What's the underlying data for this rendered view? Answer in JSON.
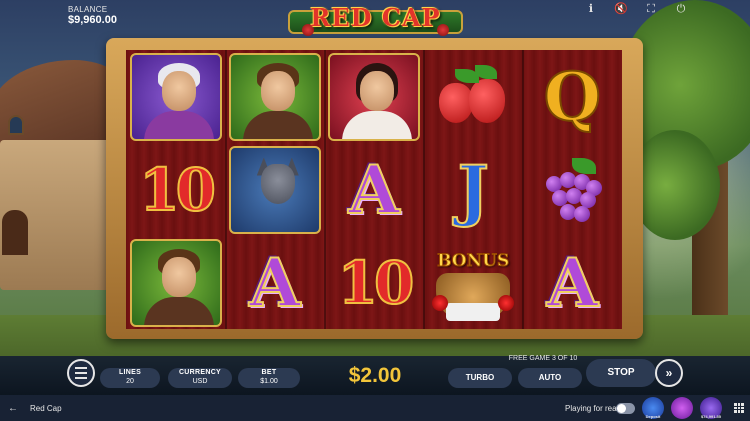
{
  "balance": {
    "label": "BALANCE",
    "value": "$9,960.00"
  },
  "logo": {
    "text": "RED CAP"
  },
  "top_icons": [
    "info-icon",
    "sound-muted-icon",
    "fullscreen-icon",
    "power-icon"
  ],
  "reels": [
    [
      "grandma",
      "10",
      "lumberjack"
    ],
    [
      "lumberjack",
      "wolf",
      "A"
    ],
    [
      "red-cap",
      "A",
      "10"
    ],
    [
      "strawberries",
      "J",
      "bonus"
    ],
    [
      "Q",
      "grapes",
      "A"
    ]
  ],
  "bonus_label": "BONUS",
  "controls": {
    "lines": {
      "label": "LINES",
      "value": "20"
    },
    "currency": {
      "label": "CURRENCY",
      "value": "USD"
    },
    "bet": {
      "label": "BET",
      "value": "$1.00"
    },
    "total_bet": "$2.00",
    "free_game": "FREE GAME 3 OF 10",
    "turbo": "TURBO",
    "auto": "AUTO",
    "stop": "STOP"
  },
  "bottom_bar": {
    "game_name": "Red Cap",
    "playing_for_real": "Playing for real",
    "playing_for_real_on": false,
    "promos": [
      {
        "text": "Deposit",
        "color": "#2a6ae0"
      },
      {
        "text": "",
        "color": "#b03ad8"
      },
      {
        "text": "$74,991.55",
        "color": "#7a3ae0"
      }
    ]
  }
}
